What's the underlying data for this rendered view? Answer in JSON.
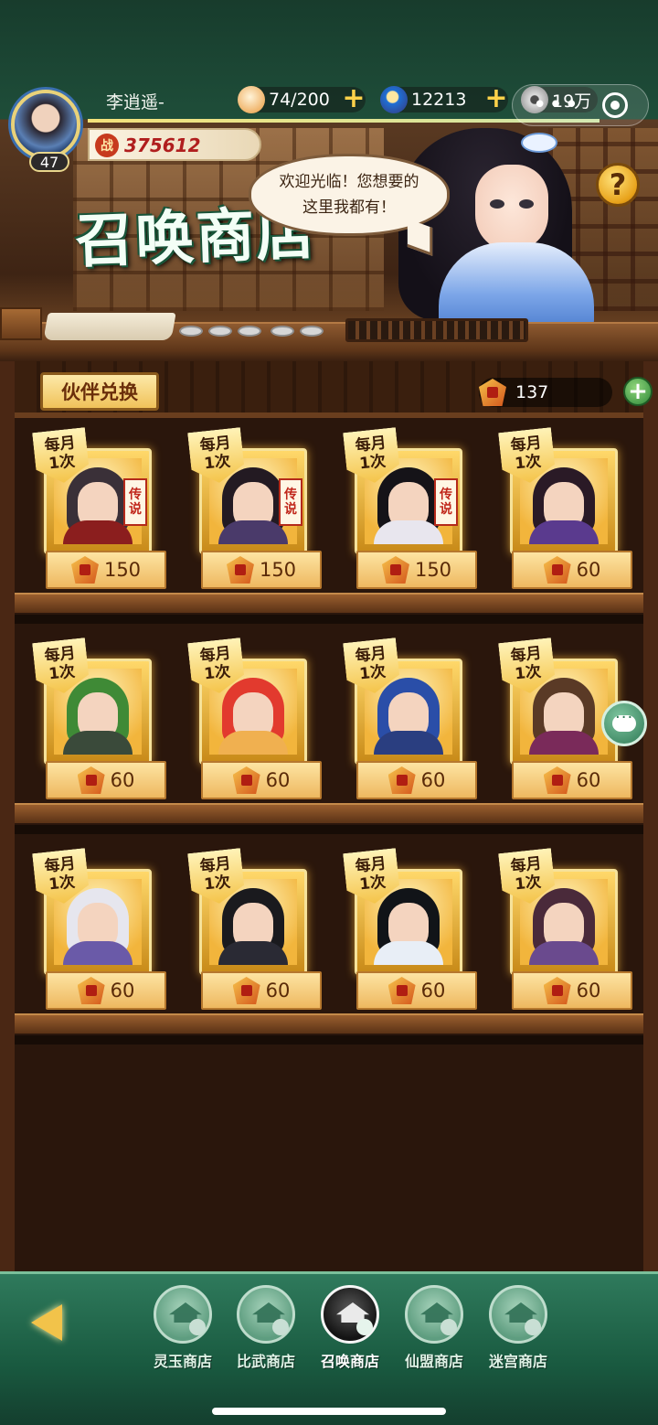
{
  "player": {
    "name": "李逍遥-",
    "level": "47",
    "power": "375612",
    "power_icon": "战"
  },
  "currencies": [
    {
      "icon": "bun-icon",
      "value": "74/200"
    },
    {
      "icon": "jade-icon",
      "value": "12213"
    },
    {
      "icon": "copper-coin-icon",
      "value": "19万"
    }
  ],
  "shop": {
    "title": "召唤商店",
    "greeting_line1": "欢迎光临！您想要的",
    "greeting_line2": "这里我都有！",
    "help": "?"
  },
  "exchange": {
    "tab_label": "伙伴兑换",
    "token_balance": "137"
  },
  "items": [
    {
      "badge_line1": "每月",
      "badge_line2": "1次",
      "price": "150",
      "legend": [
        "传",
        "说"
      ],
      "hair": "#3a3038",
      "outfit": "#8b1e1e"
    },
    {
      "badge_line1": "每月",
      "badge_line2": "1次",
      "price": "150",
      "legend": [
        "传",
        "说"
      ],
      "hair": "#231a22",
      "outfit": "#4a3a6a"
    },
    {
      "badge_line1": "每月",
      "badge_line2": "1次",
      "price": "150",
      "legend": [
        "传",
        "说"
      ],
      "hair": "#151318",
      "outfit": "#e8e6ee"
    },
    {
      "badge_line1": "每月",
      "badge_line2": "1次",
      "price": "60",
      "hair": "#2a1a26",
      "outfit": "#5a3a8e"
    },
    {
      "badge_line1": "每月",
      "badge_line2": "1次",
      "price": "60",
      "hair": "#3f8a36",
      "outfit": "#3a4a3a"
    },
    {
      "badge_line1": "每月",
      "badge_line2": "1次",
      "price": "60",
      "hair": "#e23a2e",
      "outfit": "#f0b050"
    },
    {
      "badge_line1": "每月",
      "badge_line2": "1次",
      "price": "60",
      "hair": "#2a4ea8",
      "outfit": "#2a3e80"
    },
    {
      "badge_line1": "每月",
      "badge_line2": "1次",
      "price": "60",
      "hair": "#5a3a26",
      "outfit": "#7a2a5a"
    },
    {
      "badge_line1": "每月",
      "badge_line2": "1次",
      "price": "60",
      "hair": "#e6e6ee",
      "outfit": "#6a5aa8"
    },
    {
      "badge_line1": "每月",
      "badge_line2": "1次",
      "price": "60",
      "hair": "#1a1a1e",
      "outfit": "#2a2a34"
    },
    {
      "badge_line1": "每月",
      "badge_line2": "1次",
      "price": "60",
      "hair": "#111418",
      "outfit": "#e8eef6"
    },
    {
      "badge_line1": "每月",
      "badge_line2": "1次",
      "price": "60",
      "hair": "#4a2a3a",
      "outfit": "#6a4a8e"
    }
  ],
  "nav": [
    {
      "label": "灵玉商店",
      "name": "tab-jade-shop"
    },
    {
      "label": "比武商店",
      "name": "tab-arena-shop"
    },
    {
      "label": "召唤商店",
      "name": "tab-summon-shop",
      "active": true
    },
    {
      "label": "仙盟商店",
      "name": "tab-guild-shop"
    },
    {
      "label": "迷宫商店",
      "name": "tab-maze-shop"
    }
  ],
  "colors": {
    "accent_green": "#195a40",
    "gold": "#f2c34a",
    "wood": "#2a160c"
  }
}
